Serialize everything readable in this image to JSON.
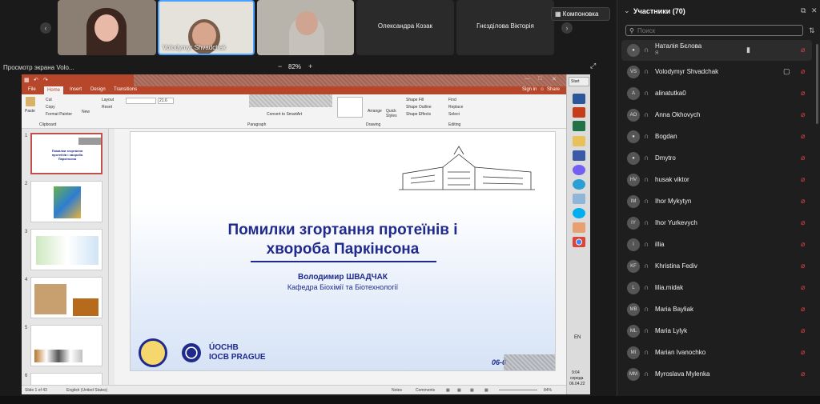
{
  "video_tiles": [
    {
      "name": "",
      "label": ""
    },
    {
      "name": "",
      "label": "Volodymyr Shvadchak"
    },
    {
      "name": "",
      "label": ""
    },
    {
      "name": "Олександра Козак",
      "label": ""
    },
    {
      "name": "Гнєздiлова Вiкторiя",
      "label": ""
    }
  ],
  "layout_button": "Компоновка",
  "screen_share": {
    "title": "Просмотр экрана Volo...",
    "zoom": "82%"
  },
  "ppt": {
    "tabs": [
      "File",
      "Home",
      "Insert",
      "Design",
      "Transitions"
    ],
    "signin": "Sign in",
    "share": "Share",
    "ribbon": {
      "cut": "Cut",
      "copy": "Copy",
      "paste": "Paste",
      "format_painter": "Format Painter",
      "clipboard": "Clipboard",
      "layout": "Layout",
      "reset": "Reset",
      "new": "New",
      "font_size": "21.6",
      "paragraph": "Paragraph",
      "convert": "Convert to SmartArt",
      "drawing": "Drawing",
      "arrange": "Arrange",
      "quick_styles": "Quick Styles",
      "shape_fill": "Shape Fill",
      "shape_outline": "Shape Outline",
      "shape_effects": "Shape Effects",
      "find": "Find",
      "replace": "Replace",
      "select": "Select",
      "editing": "Editing"
    },
    "slide_numbers": [
      "1",
      "2",
      "3",
      "4",
      "5",
      "6"
    ],
    "thumb1_title": "Помилки згортання протеїнів і хвороба Паркінсона",
    "slide": {
      "title_line1": "Помилки згортання протеїнів і",
      "title_line2": "хвороба Паркінсона",
      "author": "Володимир ШВАДЧАК",
      "dept": "Кафедра Біохімії та Біотехнології",
      "iocb_line1": "ÚOCHB",
      "iocb_line2": "IOCB PRAGUE",
      "date": "06-0"
    },
    "status": {
      "slide": "Slide 1 of 43",
      "lang": "English (United States)",
      "notes": "Notes",
      "comments": "Comments",
      "zoom": "84%"
    },
    "dock": {
      "start": "Start",
      "lang": "EN",
      "time": "9:04",
      "day": "середа",
      "date": "06.04.22"
    }
  },
  "participants": {
    "title": "Участники (70)",
    "search_placeholder": "Поиск",
    "list": [
      {
        "initials": "",
        "name": "Наталія Бєлова",
        "sub": "Я",
        "highlight": true
      },
      {
        "initials": "VS",
        "name": "Volodymyr Shvadchak",
        "sub": "",
        "highlight": false
      },
      {
        "initials": "A",
        "name": "alinatutka0",
        "sub": "",
        "highlight": false
      },
      {
        "initials": "AO",
        "name": "Anna Okhovych",
        "sub": "",
        "highlight": false
      },
      {
        "initials": "",
        "name": "Bogdan",
        "sub": "",
        "highlight": false
      },
      {
        "initials": "",
        "name": "Dmytro",
        "sub": "",
        "highlight": false
      },
      {
        "initials": "HV",
        "name": "husak viktor",
        "sub": "",
        "highlight": false
      },
      {
        "initials": "IM",
        "name": "Ihor Mykytyn",
        "sub": "",
        "highlight": false
      },
      {
        "initials": "IY",
        "name": "Ihor Yurkevych",
        "sub": "",
        "highlight": false
      },
      {
        "initials": "I",
        "name": "illia",
        "sub": "",
        "highlight": false
      },
      {
        "initials": "KF",
        "name": "Khristina Fediv",
        "sub": "",
        "highlight": false
      },
      {
        "initials": "L",
        "name": "lilia.midak",
        "sub": "",
        "highlight": false
      },
      {
        "initials": "MB",
        "name": "Maria Bayliak",
        "sub": "",
        "highlight": false
      },
      {
        "initials": "ML",
        "name": "Maria Lylyk",
        "sub": "",
        "highlight": false
      },
      {
        "initials": "MI",
        "name": "Marian Ivanochko",
        "sub": "",
        "highlight": false
      },
      {
        "initials": "MM",
        "name": "Myroslava Mylenka",
        "sub": "",
        "highlight": false
      }
    ]
  },
  "colors": {
    "ppt_accent": "#b7472a",
    "slide_text": "#1f2a8c",
    "muted_mic": "#e04040"
  }
}
